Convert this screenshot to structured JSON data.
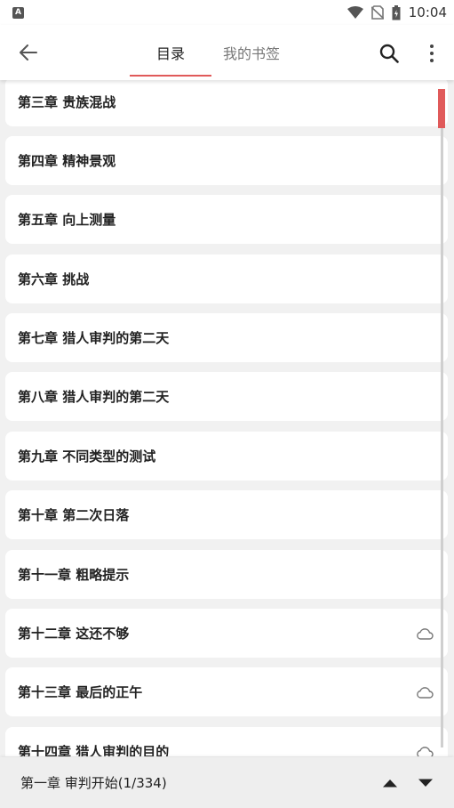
{
  "status_bar": {
    "time": "10:04",
    "icons": [
      "a-icon",
      "wifi-icon",
      "no-sim-icon",
      "battery-icon"
    ]
  },
  "app_bar": {
    "tabs": [
      {
        "label": "目录",
        "active": true
      },
      {
        "label": "我的书签",
        "active": false
      }
    ],
    "icons": [
      "back-arrow-icon",
      "search-icon",
      "more-vert-icon"
    ]
  },
  "chapters": [
    {
      "label": "第三章 贵族混战",
      "cloud": false
    },
    {
      "label": "第四章 精神景观",
      "cloud": false
    },
    {
      "label": "第五章 向上测量",
      "cloud": false
    },
    {
      "label": "第六章 挑战",
      "cloud": false
    },
    {
      "label": "第七章 猎人审判的第二天",
      "cloud": false
    },
    {
      "label": "第八章 猎人审判的第二天",
      "cloud": false
    },
    {
      "label": "第九章 不同类型的测试",
      "cloud": false
    },
    {
      "label": "第十章 第二次日落",
      "cloud": false
    },
    {
      "label": "第十一章 粗略提示",
      "cloud": false
    },
    {
      "label": "第十二章 这还不够",
      "cloud": true
    },
    {
      "label": "第十三章 最后的正午",
      "cloud": true
    },
    {
      "label": "第十四章 猎人审判的目的",
      "cloud": true
    }
  ],
  "bottom_bar": {
    "current_chapter": "第一章 审判开始(1/334)"
  },
  "colors": {
    "accent": "#e05a5a",
    "background": "#f1f1f1",
    "row_background": "#ffffff"
  }
}
